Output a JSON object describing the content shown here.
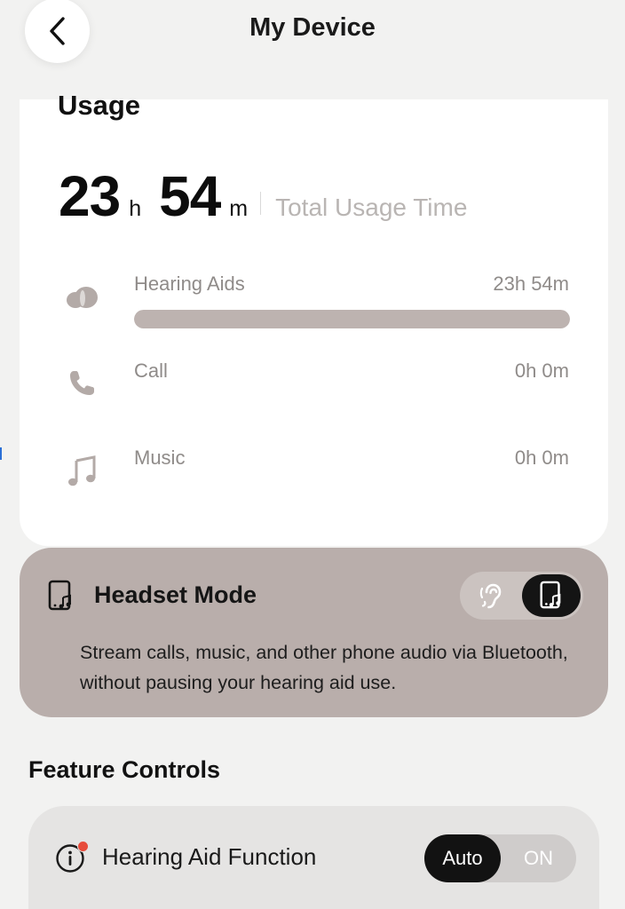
{
  "header": {
    "title": "My Device"
  },
  "usage": {
    "heading": "Usage",
    "hours": "23",
    "hours_unit": "h",
    "minutes": "54",
    "minutes_unit": "m",
    "total_label": "Total Usage Time",
    "rows": [
      {
        "label": "Hearing Aids",
        "value": "23h 54m",
        "icon": "hearing-aid-icon",
        "progress": 1.0
      },
      {
        "label": "Call",
        "value": "0h 0m",
        "icon": "phone-icon"
      },
      {
        "label": "Music",
        "value": "0h 0m",
        "icon": "music-note-icon"
      }
    ]
  },
  "headset_mode": {
    "title": "Headset Mode",
    "description": "Stream calls, music, and other phone audio via Bluetooth, without pausing your hearing aid use.",
    "selected": "phone-music"
  },
  "feature_controls": {
    "title": "Feature Controls",
    "hearing_aid_function": {
      "label": "Hearing Aid Function",
      "options": [
        "Auto",
        "ON"
      ],
      "selected": "Auto"
    }
  },
  "colors": {
    "background": "#f2f2f1",
    "card": "#ffffff",
    "accent_card": "#b9aeab",
    "progress": "#bdb3b0",
    "notification_dot": "#e74c3c"
  }
}
